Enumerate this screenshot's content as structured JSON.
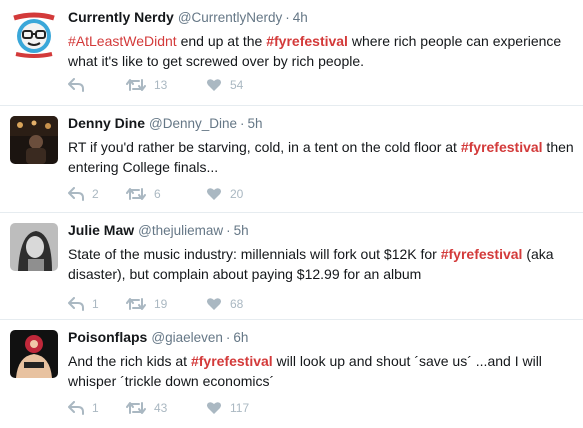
{
  "tweets": [
    {
      "name": "Currently Nerdy",
      "handle": "@CurrentlyNerdy",
      "time": "4h",
      "text_parts": [
        {
          "t": "#AtLeastWeDidnt",
          "k": "tag"
        },
        {
          "t": " end up at the ",
          "k": "text"
        },
        {
          "t": "#fyrefestival",
          "k": "hashtag"
        },
        {
          "t": " where rich people can experience what it's like to get screwed over by rich people.",
          "k": "text"
        }
      ],
      "reply_count": "",
      "retweet_count": "13",
      "like_count": "54",
      "avatar_icon": "cartoon-face-logo-icon"
    },
    {
      "name": "Denny Dine",
      "handle": "@Denny_Dine",
      "time": "5h",
      "text_parts": [
        {
          "t": "RT if you'd rather be starving, cold, in a tent on the cold floor at ",
          "k": "text"
        },
        {
          "t": "#fyrefestival",
          "k": "hashtag"
        },
        {
          "t": " then entering College finals...",
          "k": "text"
        }
      ],
      "reply_count": "2",
      "retweet_count": "6",
      "like_count": "20",
      "avatar_icon": "dark-photo-avatar"
    },
    {
      "name": "Julie Maw",
      "handle": "@thejuliemaw",
      "time": "5h",
      "text_parts": [
        {
          "t": "State of the music industry: millennials will fork out $12K for ",
          "k": "text"
        },
        {
          "t": "#fyrefestival",
          "k": "hashtag"
        },
        {
          "t": " (aka disaster), but complain about paying $12.99 for an album",
          "k": "text"
        }
      ],
      "reply_count": "1",
      "retweet_count": "19",
      "like_count": "68",
      "avatar_icon": "grayscale-portrait-avatar"
    },
    {
      "name": "Poisonflaps",
      "handle": "@giaeleven",
      "time": "6h",
      "text_parts": [
        {
          "t": "And the rich kids at ",
          "k": "text"
        },
        {
          "t": "#fyrefestival",
          "k": "hashtag"
        },
        {
          "t": " will look up and shout ´save us´ ...and I will whisper ´trickle down economics´",
          "k": "text"
        }
      ],
      "reply_count": "1",
      "retweet_count": "43",
      "like_count": "117",
      "avatar_icon": "red-photo-avatar"
    }
  ],
  "colors": {
    "hashtag": "#d33a3a",
    "icon_gray": "#aab8c2",
    "meta_gray": "#657786",
    "divider": "#e6ecf0"
  }
}
